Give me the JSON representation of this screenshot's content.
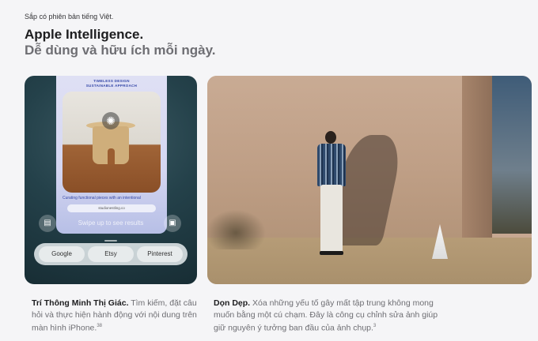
{
  "eyebrow": "Sắp có phiên bản tiếng Việt.",
  "headline": {
    "line1": "Apple Intelligence.",
    "line2": "Dễ dùng và hữu ích mỗi ngày."
  },
  "card1": {
    "phone_tag_line1": "TIMELESS DESIGN",
    "phone_tag_line2": "SUSTAINABLE APPROACH",
    "phone_caption": "Curating functional pieces with an intentional",
    "phone_url": "studionestling.co",
    "swipe_text": "Swipe up to see results",
    "search_options": [
      "Google",
      "Etsy",
      "Pinterest"
    ],
    "left_icon": "chat-bubble-icon",
    "right_icon": "image-search-icon",
    "center_icon": "visual-intelligence-icon"
  },
  "descriptions": [
    {
      "title": "Trí Thông Minh Thị Giác.",
      "body": " Tìm kiếm, đặt câu hỏi và thực hiện hành động với nội dung trên màn hình iPhone.",
      "footnote": "38"
    },
    {
      "title": "Dọn Dẹp.",
      "body": " Xóa những yếu tố gây mất tập trung không mong muốn bằng một cú chạm. Đây là công cụ chỉnh sửa ảnh giúp giữ nguyên ý tưởng ban đầu của ảnh chụp.",
      "footnote": "3"
    }
  ]
}
